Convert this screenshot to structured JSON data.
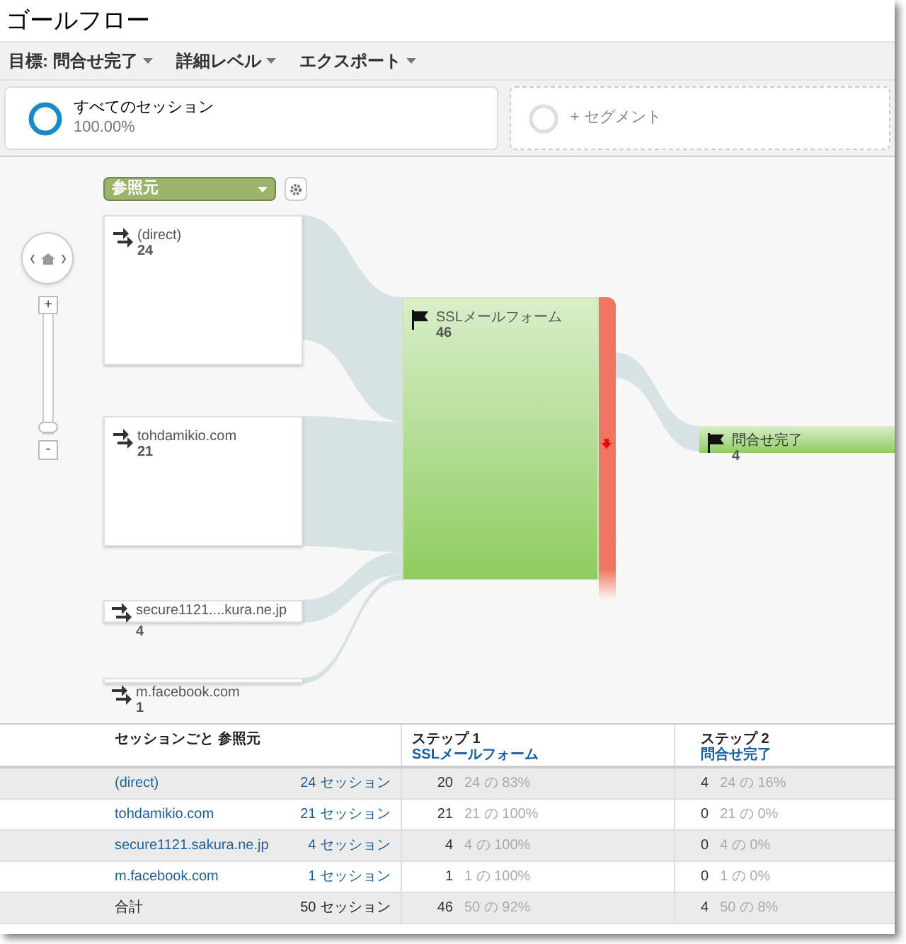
{
  "title": "ゴールフロー",
  "toolbar": [
    {
      "label": "目標: 問合せ完了",
      "dropdown": true
    },
    {
      "label": "詳細レベル",
      "dropdown": true
    },
    {
      "label": "エクスポート",
      "dropdown": true
    }
  ],
  "segments": [
    {
      "kind": "segment",
      "label": "すべてのセッション",
      "value": "100.00%"
    },
    {
      "kind": "add",
      "label": "+ セグメント"
    }
  ],
  "flow": {
    "dimension": "参照元",
    "zoom_in": "+",
    "zoom_out": "-",
    "zoom": {
      "level": 0
    },
    "sources": [
      {
        "label": "(direct)",
        "count": "24"
      },
      {
        "label": "tohdamikio.com",
        "count": "21"
      },
      {
        "label": "secure1121....kura.ne.jp",
        "count": "4"
      },
      {
        "label": "m.facebook.com",
        "count": "1"
      }
    ],
    "steps": [
      {
        "label": "SSLメールフォーム",
        "count": "46"
      },
      {
        "label": "問合せ完了",
        "count": "4"
      }
    ]
  },
  "table": {
    "columns": [
      {
        "title": "セッションごと 参照元"
      },
      {
        "title": "ステップ 1",
        "subtitle": "SSLメールフォーム"
      },
      {
        "title": "ステップ 2",
        "subtitle": "問合せ完了"
      }
    ],
    "rows": [
      {
        "kind": "row",
        "source": "(direct)",
        "sessions": "24 セッション",
        "step1_value": "20",
        "step1_ratio": "24 の 83%",
        "step2_value": "4",
        "step2_ratio": "24 の 16%"
      },
      {
        "kind": "row",
        "source": "tohdamikio.com",
        "sessions": "21 セッション",
        "step1_value": "21",
        "step1_ratio": "21 の 100%",
        "step2_value": "0",
        "step2_ratio": "21 の 0%"
      },
      {
        "kind": "row",
        "source": "secure1121.sakura.ne.jp",
        "sessions": "4 セッション",
        "step1_value": "4",
        "step1_ratio": "4 の 100%",
        "step2_value": "0",
        "step2_ratio": "4 の 0%"
      },
      {
        "kind": "row",
        "source": "m.facebook.com",
        "sessions": "1 セッション",
        "step1_value": "1",
        "step1_ratio": "1 の 100%",
        "step2_value": "0",
        "step2_ratio": "1 の 0%"
      },
      {
        "kind": "total",
        "source": "合計",
        "sessions": "50 セッション",
        "step1_value": "46",
        "step1_ratio": "50 の 92%",
        "step2_value": "4",
        "step2_ratio": "50 の 8%"
      }
    ]
  }
}
